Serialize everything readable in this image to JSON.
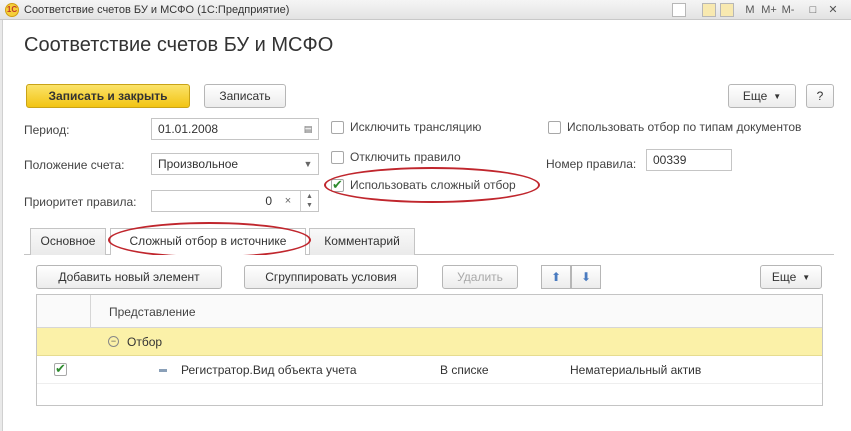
{
  "window": {
    "title": "Соответствие счетов БУ и МСФО  (1С:Предприятие)",
    "logo_text": "1С",
    "controls": [
      "M",
      "M+",
      "M-",
      "□",
      "✕"
    ]
  },
  "form": {
    "title": "Соответствие счетов БУ и МСФО"
  },
  "toolbar": {
    "save_close_label": "Записать и закрыть",
    "save_label": "Записать",
    "more_label": "Еще",
    "help_label": "?"
  },
  "fields": {
    "period_label": "Период:",
    "period_value": "01.01.2008",
    "position_label": "Положение счета:",
    "position_value": "Произвольное",
    "priority_label": "Приоритет правила:",
    "priority_value": "0",
    "rule_number_label": "Номер правила:",
    "rule_number_value": "00339"
  },
  "checkboxes": {
    "exclude_translation": {
      "label": "Исключить трансляцию",
      "checked": false
    },
    "disable_rule": {
      "label": "Отключить правило",
      "checked": false
    },
    "use_complex_filter": {
      "label": "Использовать сложный отбор",
      "checked": true
    },
    "use_doc_type_filter": {
      "label": "Использовать отбор по типам документов",
      "checked": false
    }
  },
  "tabs": [
    {
      "label": "Основное",
      "active": false
    },
    {
      "label": "Сложный отбор в источнике",
      "active": true
    },
    {
      "label": "Комментарий",
      "active": false
    }
  ],
  "tab_toolbar": {
    "add_label": "Добавить новый элемент",
    "group_label": "Сгруппировать условия",
    "delete_label": "Удалить",
    "more_label": "Еще"
  },
  "table": {
    "header": "Представление",
    "group_row": {
      "label": "Отбор"
    },
    "rows": [
      {
        "checked": true,
        "field": "Регистратор.Вид объекта учета",
        "condition": "В списке",
        "value": "Нематериальный актив"
      }
    ]
  },
  "colors": {
    "primary_button": "#f2c413",
    "highlight_row": "#fbf1a8",
    "annotation": "#c0262d"
  }
}
